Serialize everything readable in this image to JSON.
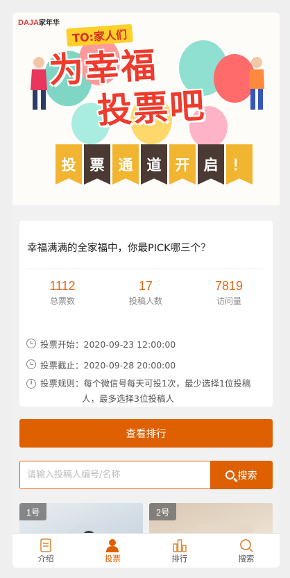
{
  "banner": {
    "brand": "DAJA",
    "brand_suffix": "家年华",
    "to_tag": "TO:家人们",
    "headline_1": "为幸福",
    "headline_2": "投票吧",
    "flags": [
      "投",
      "票",
      "通",
      "道",
      "开",
      "启",
      "！"
    ]
  },
  "question": "幸福满满的全家福中，你最PICK哪三个？",
  "stats": [
    {
      "value": "1112",
      "label": "总票数"
    },
    {
      "value": "17",
      "label": "投稿人数"
    },
    {
      "value": "7819",
      "label": "访问量"
    }
  ],
  "info": {
    "start": "投票开始：2020-09-23 12:00:00",
    "end": "投票截止：2020-09-28 20:00:00",
    "rules_1": "投票规则：每个微信号每天可投1次，最少选择1位投稿",
    "rules_2": "人，最多选择3位投稿人"
  },
  "rank_button": "查看排行",
  "search": {
    "placeholder": "请输入投稿人编号/名称",
    "button": "搜索"
  },
  "tiles": [
    {
      "badge": "1号"
    },
    {
      "badge": "2号"
    }
  ],
  "tabs": [
    {
      "label": "介绍",
      "icon": "document-icon"
    },
    {
      "label": "投票",
      "icon": "person-icon",
      "active": true
    },
    {
      "label": "排行",
      "icon": "bar-chart-icon"
    },
    {
      "label": "搜索",
      "icon": "search-icon"
    }
  ],
  "colors": {
    "accent": "#de6000",
    "headline": "#ee3b2c",
    "stat_number": "#e16a1a"
  }
}
